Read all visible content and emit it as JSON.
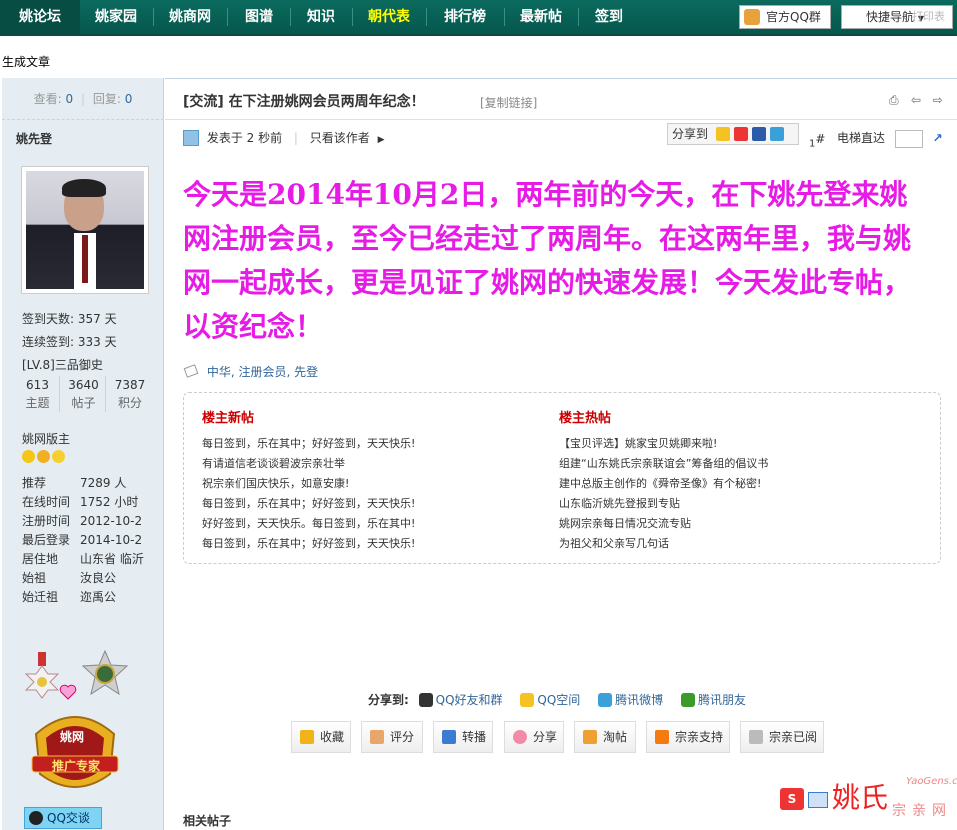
{
  "nav": {
    "items": [
      "姚论坛",
      "姚家园",
      "姚商网",
      "图谱",
      "知识",
      "朝代表",
      "排行榜",
      "最新帖",
      "签到"
    ],
    "qq_group": "官方QQ群",
    "quick_nav": "快捷导航",
    "quick_nav_ghost": "打印表",
    "colors": {
      "bar": "#0b6a5e",
      "highlight": "#ffff00"
    }
  },
  "breadcrumb_note": "生成文章",
  "sidebar": {
    "views_label": "查看:",
    "views": "0",
    "replies_label": "回复:",
    "replies": "0",
    "username": "姚先登",
    "signin_days": "签到天数: 357 天",
    "continuous": "连续签到: 333 天",
    "level": "[LV.8]三品御史",
    "stats": [
      {
        "value": "613",
        "label": "主题"
      },
      {
        "value": "3640",
        "label": "帖子"
      },
      {
        "value": "7387",
        "label": "积分"
      }
    ],
    "role": "姚网版主",
    "info": [
      {
        "k": "推荐",
        "v": "7289 人"
      },
      {
        "k": "在线时间",
        "v": "1752 小时"
      },
      {
        "k": "注册时间",
        "v": "2012-10-2"
      },
      {
        "k": "最后登录",
        "v": "2014-10-2"
      },
      {
        "k": "居住地",
        "v": "山东省 临沂"
      },
      {
        "k": "始祖",
        "v": "汝良公"
      },
      {
        "k": "始迁祖",
        "v": "迩禹公"
      }
    ],
    "badge_top": "姚网",
    "badge_bottom": "推广专家",
    "qq_talk": "QQ交谈"
  },
  "post": {
    "category": "[交流]",
    "title": "在下注册姚网会员两周年纪念！",
    "copy_link": "[复制链接]",
    "posted": "发表于 2 秒前",
    "author_only": "只看该作者",
    "share_to": "分享到",
    "floor_num": "1",
    "floor_sym": "#",
    "elevator": "电梯直达",
    "content": "今天是2014年10月2日，两年前的今天，在下姚先登来姚网注册会员，至今已经走过了两周年。在这两年里，我与姚网一起成长，更是见证了姚网的快速发展！今天发此专帖，以资纪念！",
    "tags": "中华, 注册会员, 先登"
  },
  "new_posts": {
    "heading": "楼主新帖",
    "items": [
      "每日签到，乐在其中；好好签到，天天快乐!",
      "有请道信老谈谈碧波宗亲壮举",
      "祝宗亲们国庆快乐，如意安康!",
      "每日签到，乐在其中；好好签到，天天快乐!",
      "好好签到，天天快乐。每日签到，乐在其中!",
      "每日签到，乐在其中；好好签到，天天快乐!"
    ]
  },
  "hot_posts": {
    "heading": "楼主热帖",
    "items": [
      "【宝贝评选】姚家宝贝姚卿来啦!",
      "组建“山东姚氏宗亲联谊会”筹备组的倡议书",
      "建中总版主创作的《舜帝圣像》有个秘密!",
      "山东临沂姚先登报到专贴",
      "姚网宗亲每日情况交流专贴",
      "为祖父和父亲写几句话"
    ]
  },
  "share_bar": {
    "label": "分享到:",
    "items": [
      "QQ好友和群",
      "QQ空间",
      "腾讯微博",
      "腾讯朋友"
    ]
  },
  "actions": [
    "收藏",
    "评分",
    "转播",
    "分享",
    "淘帖",
    "宗亲支持",
    "宗亲已阅"
  ],
  "related": "相关帖子",
  "logo": {
    "brand": "姚氏",
    "site": "YaoGens.cn",
    "sub": "宗亲网"
  }
}
